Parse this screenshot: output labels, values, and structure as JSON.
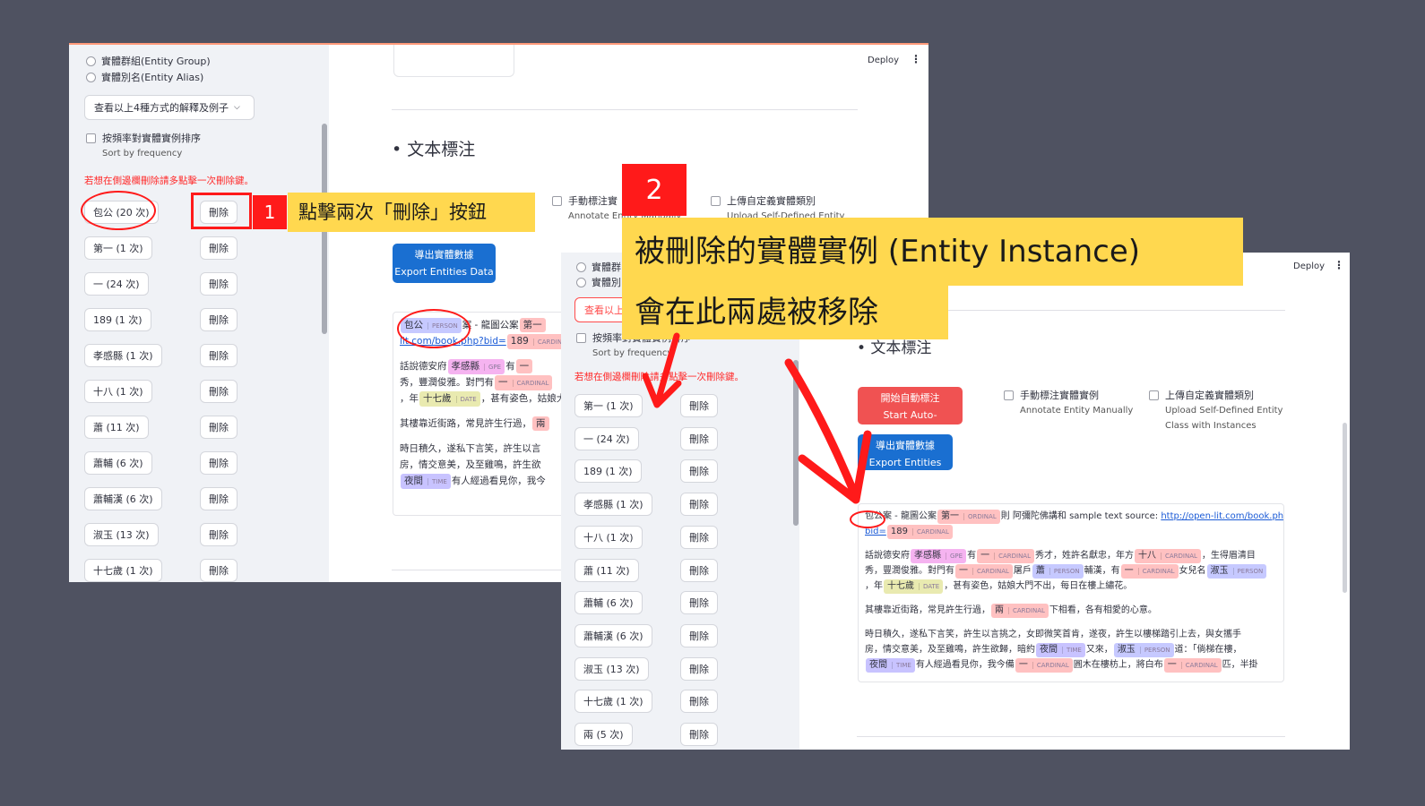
{
  "sidebar": {
    "radio_group": "實體群組(Entity Group)",
    "radio_alias": "實體別名(Entity Alias)",
    "expander_label": "查看以上4種方式的解釋及例子",
    "sort_label": "按頻率對實體實例排序",
    "sort_sub": "Sort by frequency",
    "delete_note": "若想在側邊欄刪除請多點擊一次刪除鍵。",
    "delete_label": "刪除",
    "entities_before": [
      "包公 (20 次)",
      "第一 (1 次)",
      "一 (24 次)",
      "189 (1 次)",
      "孝感縣 (1 次)",
      "十八 (1 次)",
      "蕭 (11 次)",
      "蕭輔 (6 次)",
      "蕭輔漢 (6 次)",
      "淑玉 (13 次)",
      "十七歲 (1 次)"
    ],
    "entities_after": [
      "第一 (1 次)",
      "一 (24 次)",
      "189 (1 次)",
      "孝感縣 (1 次)",
      "十八 (1 次)",
      "蕭 (11 次)",
      "蕭輔 (6 次)",
      "蕭輔漢 (6 次)",
      "淑玉 (13 次)",
      "十七歲 (1 次)",
      "兩 (5 次)"
    ],
    "partial_radio_1": "實體群",
    "partial_radio_2": "實體別",
    "partial_expander": "查看以上"
  },
  "main": {
    "deploy": "Deploy",
    "kebab": "⋮",
    "section_title": "• 文本標注",
    "auto_annotate": {
      "zh": "開始自動標注",
      "en": "Start Auto-Annotation"
    },
    "manual": {
      "zh": "手動標注實體實例",
      "en": "Annotate Entity Manually"
    },
    "manual_partial": {
      "zh": "手動標注實",
      "en": "Annotate Entity Manually"
    },
    "upload": {
      "zh": "上傳自定義實體類別",
      "en1": "Upload Self-Defined Entity",
      "en2": "Class with Instances"
    },
    "upload_partial": {
      "zh": "上傳自定義實體類別",
      "en": "Upload Self-Defined Entity"
    },
    "export": {
      "zh": "導出實體數據",
      "en": "Export Entities Data"
    }
  },
  "text": {
    "line1_a": "包公",
    "line1_b": "案 - 龍圖公案",
    "line1_c": "第一",
    "line1_d": "則 阿彌陀佛講和 sample text source:",
    "link": "http://open-lit.com/book.ph",
    "link2": "bid=",
    "link_short": "lit.com/book.php?bid=",
    "n189": "189",
    "p2_a": "話說德安府",
    "p2_gpe": "孝感縣",
    "p2_b": "有",
    "p2_c": "秀才，姓許名獻忠，年方",
    "p2_18": "十八",
    "p2_d": "，生得眉清目",
    "p3_a": "秀，豐潤俊雅。對門有",
    "p3_b": "屠戶",
    "p3_xiao": "蕭",
    "p3_c": "輔漢，有",
    "p3_d": "女兒名",
    "p3_shuyu": "淑玉",
    "p4_a": "，年",
    "p4_17": "十七歲",
    "p4_b": "，甚有姿色，姑娘大門不出，每日在樓上繡花。",
    "p5_a": "其樓靠近街路，常見許生行過，",
    "p5_liang": "兩",
    "p5_b": "下相看，各有相愛的心意。",
    "p6_a": "時日積久，遂私下言笑，許生以言挑之，女即微笑首肯，遂夜，許生以樓梯踏引上去，與女攜手",
    "p7_a": "房，情交意美，及至雞鳴，許生欲歸，暗約",
    "p7_night": "夜間",
    "p7_b": "又來，",
    "p7_c": "道：「倘梯在樓，",
    "p8_a": "有人經過看見你，我今備",
    "p8_b": "圓木在樓枋上，將白布",
    "p8_c": "匹，半掛",
    "lbl_person": "PERSON",
    "lbl_gpe": "GPE",
    "lbl_cardinal": "CARDINAL",
    "lbl_ordinal": "ORDINAL",
    "lbl_date": "DATE",
    "lbl_time": "TIME",
    "yi": "一",
    "p3_short": "秀，豐潤俊雅。對門有",
    "p6_short": "時日積久，遂私下言笑，許生以言",
    "p7_short": "房，情交意美，及至雞鳴，許生欲",
    "p8_short": "有人經過看見你，我今"
  },
  "annotations": {
    "step1_num": "1",
    "step1_text": "點擊兩次「刪除」按鈕",
    "step2_num": "2",
    "step2_line1": "被刪除的實體實例 (Entity Instance)",
    "step2_line2": "會在此兩處被移除"
  }
}
